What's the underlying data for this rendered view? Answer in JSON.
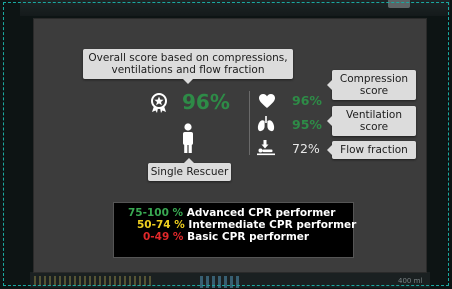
{
  "colors": {
    "panel": "#3c3c3c",
    "score_green": "#2e8b47",
    "legend_green": "#39a852",
    "legend_yellow": "#f0d020",
    "legend_red": "#e0282a"
  },
  "background": {
    "unit_text": "400 ml"
  },
  "overall": {
    "tooltip": "Overall score based on compressions, ventilations and flow fraction",
    "value": "96%",
    "icon": "medal-icon"
  },
  "rescuer": {
    "icon": "person-icon",
    "label": "Single Rescuer"
  },
  "metrics": [
    {
      "icon": "heart-icon",
      "value": "96%",
      "label": "Compression score"
    },
    {
      "icon": "lungs-icon",
      "value": "95%",
      "label": "Ventilation score"
    },
    {
      "icon": "flow-fraction-icon",
      "value": "72%",
      "label": "Flow fraction"
    }
  ],
  "legend": [
    {
      "range": "75-100 %",
      "label": "Advanced CPR performer",
      "color": "#39a852"
    },
    {
      "range": "50-74 %",
      "label": "Intermediate CPR performer",
      "color": "#f0d020"
    },
    {
      "range": "0-49 %",
      "label": "Basic CPR performer",
      "color": "#e0282a"
    }
  ]
}
